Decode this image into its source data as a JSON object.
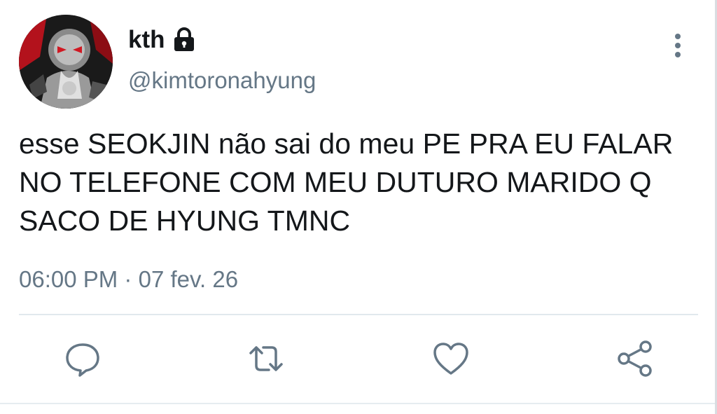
{
  "tweet": {
    "display_name": "kth",
    "handle": "@kimtoronahyung",
    "text": "esse SEOKJIN não sai do meu PE PRA EU FALAR NO TELEFONE COM MEU DUTURO MARIDO Q SACO DE HYUNG TMNC",
    "time": "06:00 PM",
    "separator": "·",
    "date": "07 fev. 26"
  },
  "icons": {
    "lock": "lock-icon",
    "more": "more-vertical-icon",
    "reply": "reply-icon",
    "retweet": "retweet-icon",
    "like": "heart-icon",
    "share": "share-icon"
  },
  "colors": {
    "text": "#14171a",
    "secondary": "#657786",
    "divider": "#e1e8ed"
  }
}
